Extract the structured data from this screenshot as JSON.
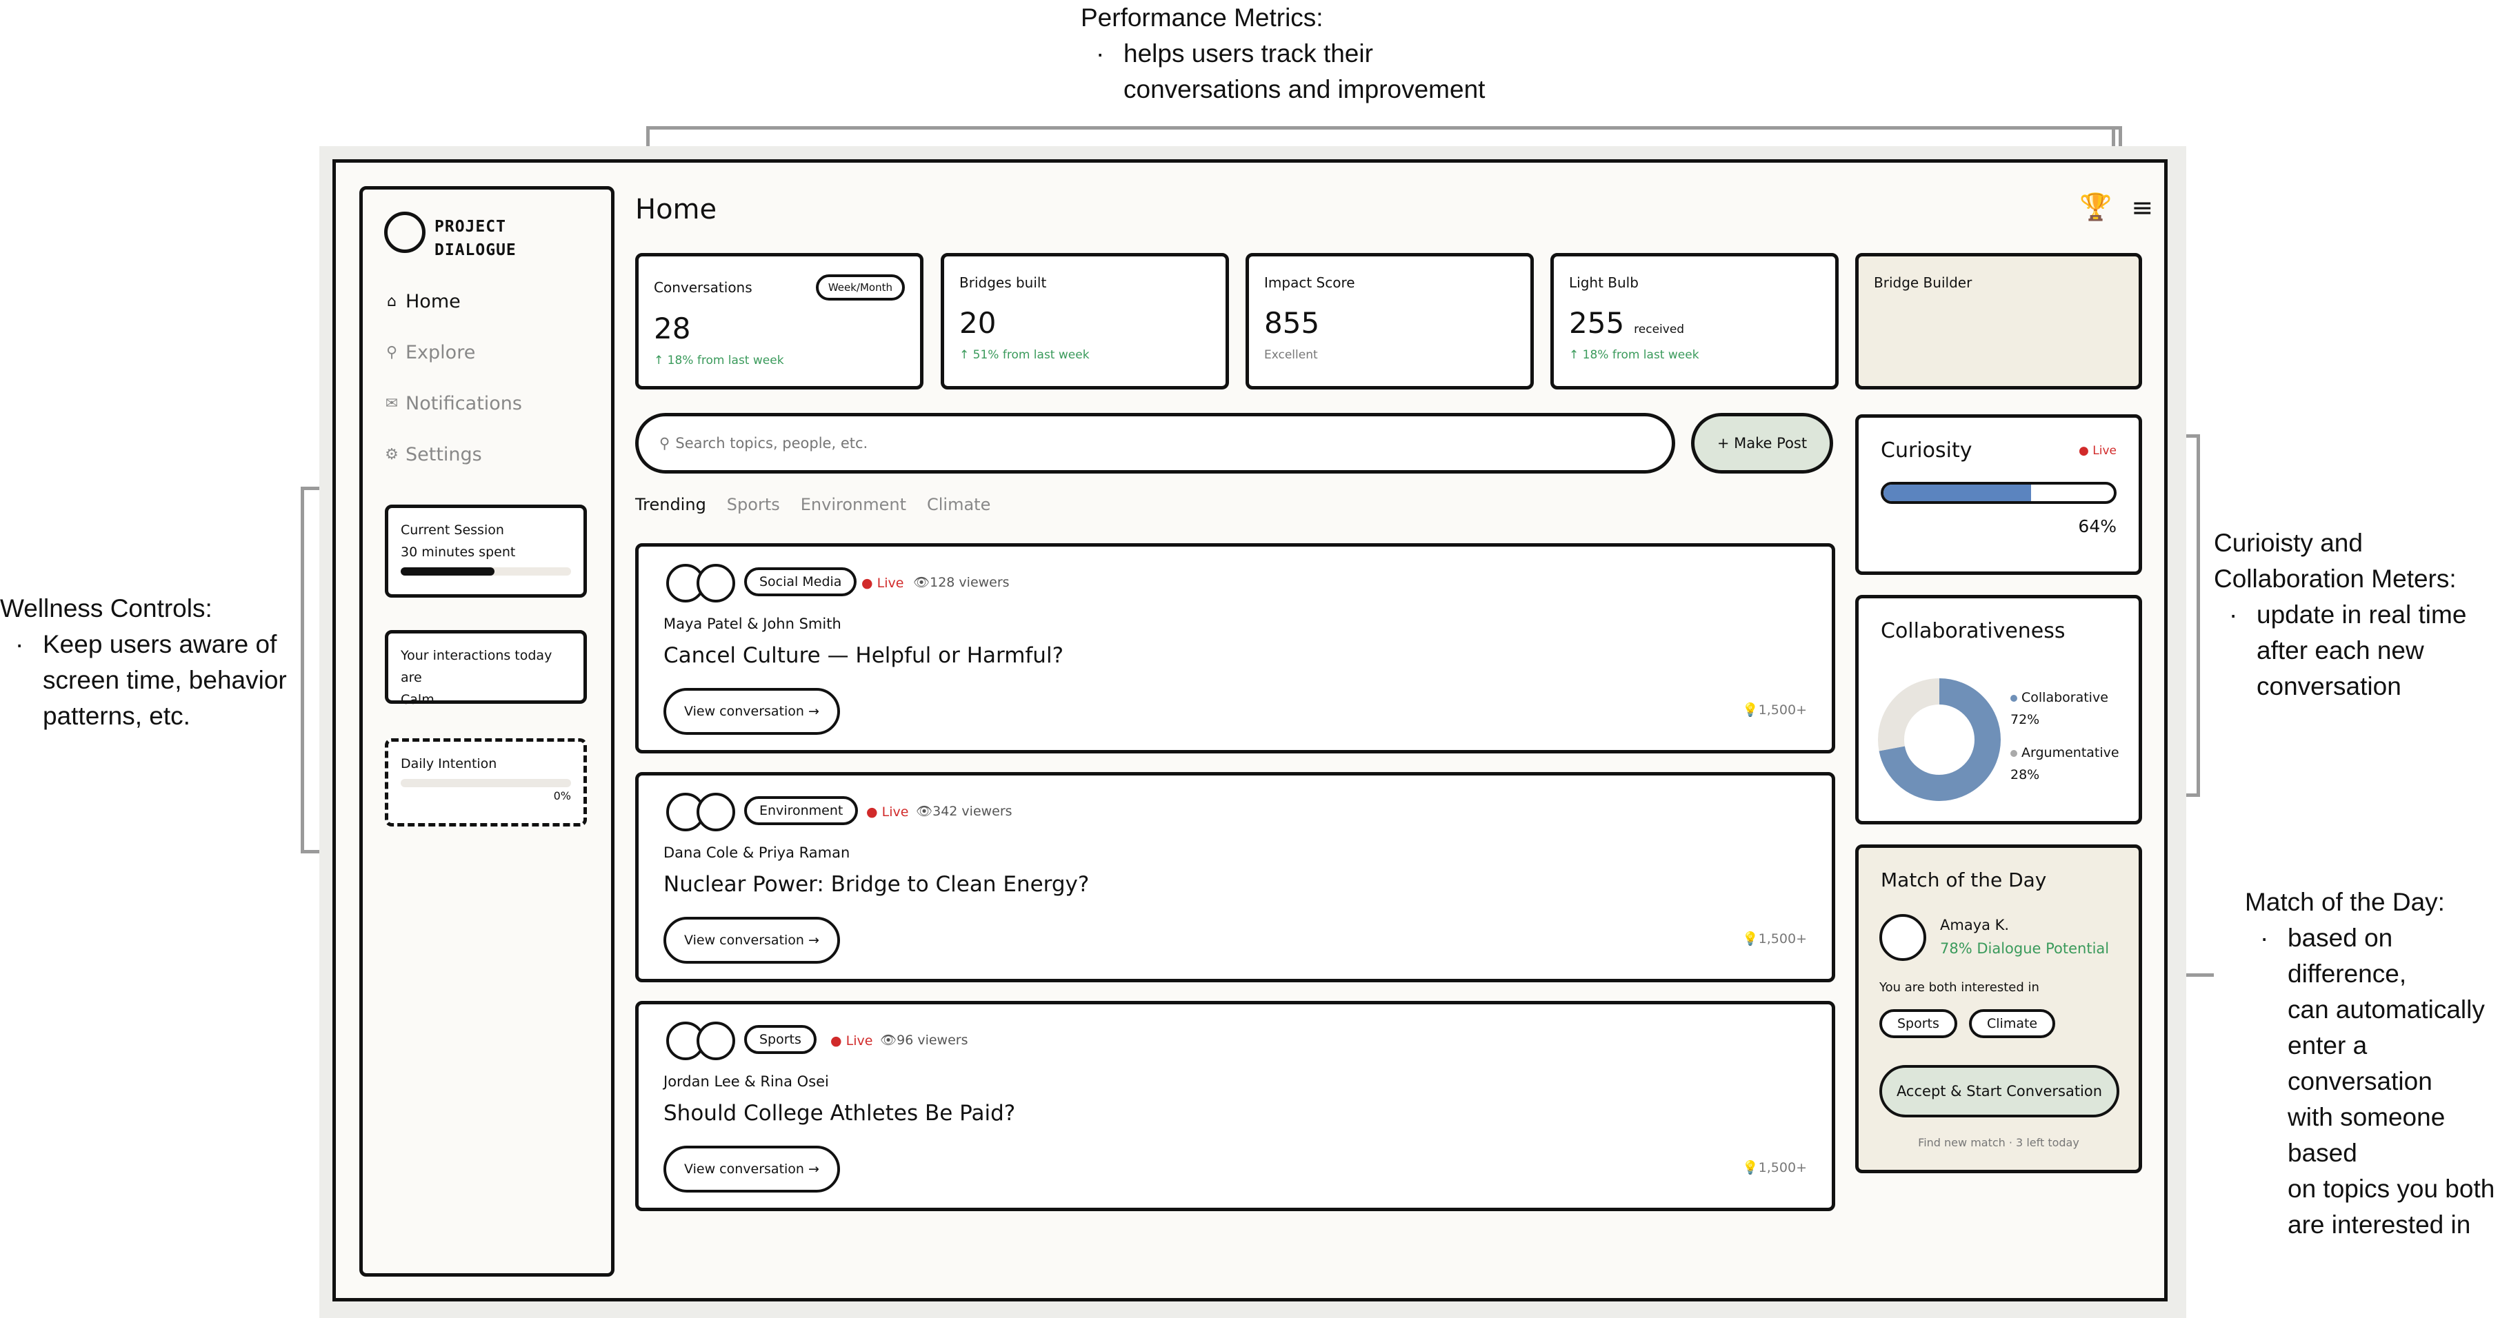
{
  "annotations": {
    "performance": {
      "title": "Performance Metrics:",
      "bullet_line1": "helps users track their",
      "bullet_line2": "conversations and improvement"
    },
    "wellness": {
      "title": "Wellness Controls:",
      "bullet_line1": "Keep users aware of",
      "bullet_line2": "screen time, behavior",
      "bullet_line3": "patterns, etc."
    },
    "meters": {
      "title_line1": "Curioisty and",
      "title_line2": "Collaboration Meters:",
      "bullet_line1": "update in real time",
      "bullet_line2": "after each new",
      "bullet_line3": "conversation"
    },
    "match": {
      "title": "Match of the Day:",
      "bullet_line1": "based on difference,",
      "bullet_line2": "can automatically",
      "bullet_line3": "enter a conversation",
      "bullet_line4": "with someone based",
      "bullet_line5": "on topics you both",
      "bullet_line6": "are interested in"
    },
    "bullet_char": "·"
  },
  "sidebar": {
    "logo_line1": "PROJECT",
    "logo_line2": "DIALOGUE",
    "nav": [
      {
        "icon": "⌂",
        "label": "Home"
      },
      {
        "icon": "⚲",
        "label": "Explore"
      },
      {
        "icon": "✉",
        "label": "Notifications"
      },
      {
        "icon": "⚙",
        "label": "Settings"
      }
    ],
    "session": {
      "title": "Current Session",
      "subtitle": "30 minutes spent",
      "progress": 0.55
    },
    "interactions": {
      "line1": "Your interactions today are",
      "line2": "Calm"
    },
    "intention": {
      "title": "Daily Intention",
      "percent_label": "0%",
      "progress": 0.0
    }
  },
  "header": {
    "title": "Home",
    "trophy_icon": "🏆",
    "menu_icon": "≡"
  },
  "stats": [
    {
      "label": "Conversations",
      "value": "28",
      "sub": "↑ 18% from last week",
      "toggle": "Week/Month"
    },
    {
      "label": "Bridges built",
      "value": "20",
      "sub": "↑ 51% from last week"
    },
    {
      "label": "Impact Score",
      "value": "855",
      "sub": "Excellent"
    },
    {
      "label": "Light Bulb",
      "value": "255",
      "value_suffix": "received",
      "sub": "↑ 18% from last week"
    }
  ],
  "bridge_builder": {
    "label": "Bridge Builder"
  },
  "search": {
    "placeholder": "Search topics, people, etc.",
    "icon": "⚲"
  },
  "make_post_label": "+ Make Post",
  "tabs": [
    "Trending",
    "Sports",
    "Environment",
    "Climate"
  ],
  "posts": [
    {
      "tag": "Social Media",
      "live": "● Live",
      "viewers": "👁128 viewers",
      "names": "Maya Patel & John Smith",
      "title": "Cancel Culture — Helpful or Harmful?",
      "button": "View conversation →",
      "bulbs": "💡1,500+"
    },
    {
      "tag": "Environment",
      "live": "● Live",
      "viewers": "👁342 viewers",
      "names": "Dana Cole & Priya Raman",
      "title": "Nuclear Power: Bridge to Clean Energy?",
      "button": "View conversation →",
      "bulbs": "💡1,500+"
    },
    {
      "tag": "Sports",
      "live": "● Live",
      "viewers": "👁96 viewers",
      "names": "Jordan Lee & Rina Osei",
      "title": "Should College Athletes Be Paid?",
      "button": "View conversation →",
      "bulbs": "💡1,500+"
    }
  ],
  "curiosity": {
    "title": "Curiosity",
    "live": "● Live",
    "percent_label": "64%",
    "value": 0.64,
    "color": "#5b84bf"
  },
  "collaboration": {
    "title": "Collaborativeness",
    "segments": [
      {
        "label": "Collaborative",
        "percent_label": "72%",
        "value": 72,
        "color": "#6f90b8"
      },
      {
        "label": "Argumentative",
        "percent_label": "28%",
        "value": 28,
        "color": "#e8e5df"
      }
    ]
  },
  "match": {
    "title": "Match of the Day",
    "name": "Amaya K.",
    "potential": "78% Dialogue Potential",
    "interest_text": "You are both interested in",
    "chips": [
      "Sports",
      "Climate"
    ],
    "accept_label": "Accept & Start Conversation",
    "footer": "Find new match · 3 left today"
  },
  "colors": {
    "green": "#3a9a5b",
    "live_red": "#d12a2a",
    "accent_green_bg": "#dde6da",
    "beige": "#f2eee3"
  }
}
